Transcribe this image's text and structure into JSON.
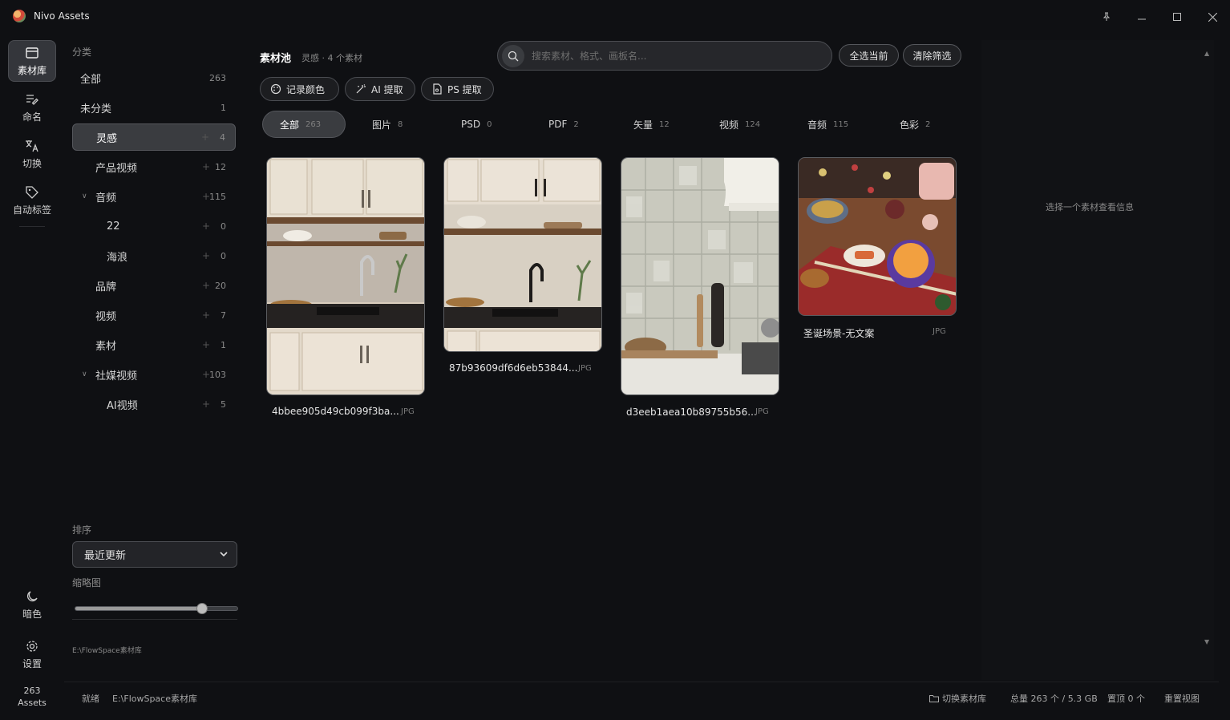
{
  "app": {
    "title": "Nivo Assets"
  },
  "rail": {
    "items": [
      {
        "label": "素材库",
        "icon": "folder-icon"
      },
      {
        "label": "命名",
        "icon": "rename-icon"
      },
      {
        "label": "切换",
        "icon": "translate-icon"
      },
      {
        "label": "自动标签",
        "icon": "tag-icon"
      }
    ],
    "theme_label": "暗色",
    "settings_label": "设置",
    "asset_count": "263",
    "asset_unit": "Assets"
  },
  "sidebar": {
    "header": "分类",
    "categories": [
      {
        "name": "全部",
        "count": "263",
        "level": 0,
        "plus": false
      },
      {
        "name": "未分类",
        "count": "1",
        "level": 0,
        "plus": false
      },
      {
        "name": "灵感",
        "count": "4",
        "level": 1,
        "plus": true,
        "active": true
      },
      {
        "name": "产品视频",
        "count": "12",
        "level": 1,
        "plus": true
      },
      {
        "name": "音频",
        "count": "115",
        "level": 1,
        "plus": true,
        "caret": true
      },
      {
        "name": "22",
        "count": "0",
        "level": 2,
        "plus": true
      },
      {
        "name": "海浪",
        "count": "0",
        "level": 2,
        "plus": true
      },
      {
        "name": "品牌",
        "count": "20",
        "level": 1,
        "plus": true
      },
      {
        "name": "视频",
        "count": "7",
        "level": 1,
        "plus": true
      },
      {
        "name": "素材",
        "count": "1",
        "level": 1,
        "plus": true
      },
      {
        "name": "社媒视频",
        "count": "103",
        "level": 1,
        "plus": true,
        "caret": true
      },
      {
        "name": "AI视频",
        "count": "5",
        "level": 2,
        "plus": true
      }
    ],
    "sort_label": "排序",
    "sort_value": "最近更新",
    "thumb_label": "缩略图",
    "thumb_size": 0.78,
    "library_path": "E:\\FlowSpace素材库"
  },
  "main": {
    "title": "素材池",
    "subtitle": "灵感 · 4 个素材",
    "search_placeholder": "搜索素材、格式、画板名...",
    "select_all_label": "全选当前",
    "clear_filter_label": "清除筛选",
    "tools": [
      {
        "label": "记录颜色",
        "icon": "palette-icon"
      },
      {
        "label": "AI 提取",
        "icon": "magic-wand-icon"
      },
      {
        "label": "PS 提取",
        "icon": "document-icon"
      }
    ],
    "tabs": [
      {
        "label": "全部",
        "count": "263",
        "active": true
      },
      {
        "label": "图片",
        "count": "8"
      },
      {
        "label": "PSD",
        "count": "0"
      },
      {
        "label": "PDF",
        "count": "2"
      },
      {
        "label": "矢量",
        "count": "12"
      },
      {
        "label": "视频",
        "count": "124"
      },
      {
        "label": "音频",
        "count": "115"
      },
      {
        "label": "色彩",
        "count": "2"
      }
    ],
    "assets": [
      {
        "name": "4bbee905d49cb099f3ba...",
        "ext": "JPG"
      },
      {
        "name": "87b93609df6d6eb53844...",
        "ext": "JPG"
      },
      {
        "name": "d3eeb1aea10b89755b56...",
        "ext": "JPG"
      },
      {
        "name": "圣诞场景-无文案",
        "ext": "JPG"
      }
    ]
  },
  "right_panel": {
    "message": "选择一个素材查看信息"
  },
  "status": {
    "state": "就绪",
    "path": "E:\\FlowSpace素材库",
    "switch_label": "切换素材库",
    "total": "总量 263 个 / 5.3 GB",
    "pinned": "置顶 0 个",
    "reset_label": "重置视图"
  }
}
